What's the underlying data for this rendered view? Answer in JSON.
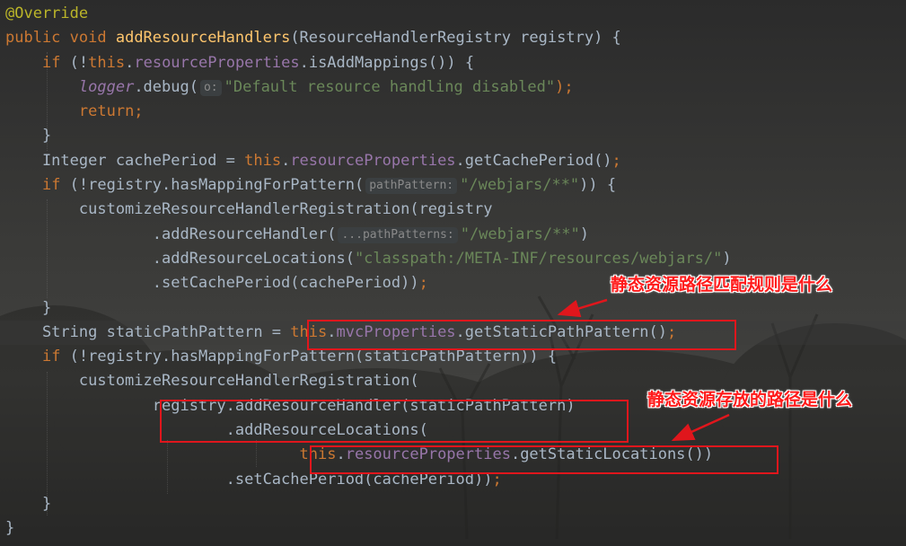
{
  "editor": {
    "lines": [
      [
        {
          "t": "@Override",
          "c": "ann"
        }
      ],
      [
        {
          "t": "public ",
          "c": "kw"
        },
        {
          "t": "void ",
          "c": "kw"
        },
        {
          "t": "addResourceHandlers",
          "c": "fn"
        },
        {
          "t": "(ResourceHandlerRegistry registry) {"
        }
      ],
      [
        {
          "t": "    "
        },
        {
          "t": "if ",
          "c": "kw"
        },
        {
          "t": "(!"
        },
        {
          "t": "this",
          "c": "kw"
        },
        {
          "t": "."
        },
        {
          "t": "resourceProperties",
          "c": "fld"
        },
        {
          "t": ".isAddMappings()) {"
        }
      ],
      [
        {
          "t": "        "
        },
        {
          "t": "logger",
          "c": "log"
        },
        {
          "t": ".debug("
        },
        {
          "t": "o:",
          "c": "hint"
        },
        {
          "t": "\"Default resource handling disabled\"",
          "c": "str"
        },
        {
          "t": ");",
          "c": "kw"
        }
      ],
      [
        {
          "t": "        "
        },
        {
          "t": "return;",
          "c": "kw"
        }
      ],
      [
        {
          "t": "    }"
        }
      ],
      [
        {
          "t": "    Integer cachePeriod = "
        },
        {
          "t": "this",
          "c": "kw"
        },
        {
          "t": "."
        },
        {
          "t": "resourceProperties",
          "c": "fld"
        },
        {
          "t": ".getCachePeriod()"
        },
        {
          "t": ";",
          "c": "kw"
        }
      ],
      [
        {
          "t": "    "
        },
        {
          "t": "if ",
          "c": "kw"
        },
        {
          "t": "(!registry.hasMappingForPattern("
        },
        {
          "t": "pathPattern:",
          "c": "hint"
        },
        {
          "t": "\"/webjars/**\"",
          "c": "str"
        },
        {
          "t": ")) {"
        }
      ],
      [
        {
          "t": "        customizeResourceHandlerRegistration(registry"
        }
      ],
      [
        {
          "t": "                .addResourceHandler("
        },
        {
          "t": "...pathPatterns:",
          "c": "hint"
        },
        {
          "t": "\"/webjars/**\"",
          "c": "str"
        },
        {
          "t": ")"
        }
      ],
      [
        {
          "t": "                .addResourceLocations("
        },
        {
          "t": "\"classpath:/META-INF/resources/webjars/\"",
          "c": "str"
        },
        {
          "t": ")"
        }
      ],
      [
        {
          "t": "                .setCachePeriod(cachePeriod))"
        },
        {
          "t": ";",
          "c": "kw"
        }
      ],
      [
        {
          "t": "    }"
        }
      ],
      [
        {
          "t": "    String staticPathPattern = "
        },
        {
          "t": "this",
          "c": "kw"
        },
        {
          "t": "."
        },
        {
          "t": "mvcProperties",
          "c": "fld"
        },
        {
          "t": ".getStaticPathPattern()"
        },
        {
          "t": ";",
          "c": "kw"
        }
      ],
      [
        {
          "t": "    "
        },
        {
          "t": "if ",
          "c": "kw"
        },
        {
          "t": "(!registry.hasMappingForPattern(staticPathPattern)) {"
        }
      ],
      [
        {
          "t": "        customizeResourceHandlerRegistration("
        }
      ],
      [
        {
          "t": "                registry.addResourceHandler(staticPathPattern)"
        }
      ],
      [
        {
          "t": "                        .addResourceLocations("
        }
      ],
      [
        {
          "t": "                                "
        },
        {
          "t": "this",
          "c": "kw"
        },
        {
          "t": "."
        },
        {
          "t": "resourceProperties",
          "c": "fld"
        },
        {
          "t": ".getStaticLocations())"
        }
      ],
      [
        {
          "t": "                        .setCachePeriod(cachePeriod))"
        },
        {
          "t": ";",
          "c": "kw"
        }
      ],
      [
        {
          "t": "    }"
        }
      ],
      [
        {
          "t": "}"
        }
      ]
    ]
  },
  "annotations": {
    "note1": "静态资源路径匹配规则是什么",
    "note2": "静态资源存放的路径是什么",
    "highlight_color": "#e0161c"
  }
}
